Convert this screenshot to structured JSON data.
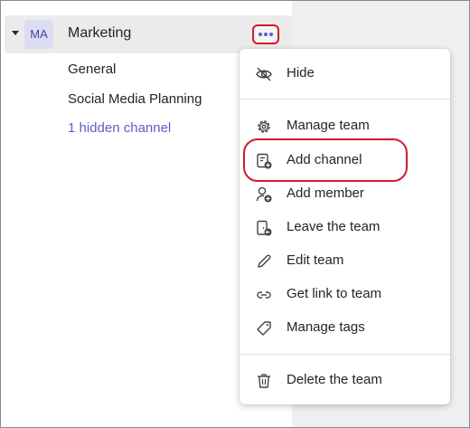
{
  "team": {
    "avatar_initials": "MA",
    "name": "Marketing",
    "more_options_icon": "ellipsis-icon"
  },
  "channels": [
    {
      "label": "General"
    },
    {
      "label": "Social Media Planning"
    },
    {
      "label": "1 hidden channel"
    }
  ],
  "menu": {
    "items": [
      {
        "label": "Hide",
        "icon": "eye-off-icon"
      },
      {
        "label": "Manage team",
        "icon": "gear-icon"
      },
      {
        "label": "Add channel",
        "icon": "add-channel-icon"
      },
      {
        "label": "Add member",
        "icon": "add-person-icon"
      },
      {
        "label": "Leave the team",
        "icon": "leave-icon"
      },
      {
        "label": "Edit team",
        "icon": "pencil-icon"
      },
      {
        "label": "Get link to team",
        "icon": "link-icon"
      },
      {
        "label": "Manage tags",
        "icon": "tag-icon"
      },
      {
        "label": "Delete the team",
        "icon": "trash-icon"
      }
    ]
  },
  "colors": {
    "accent": "#5b5fc7",
    "highlight": "#d11b2c",
    "avatar_bg": "#dcdcf3"
  }
}
